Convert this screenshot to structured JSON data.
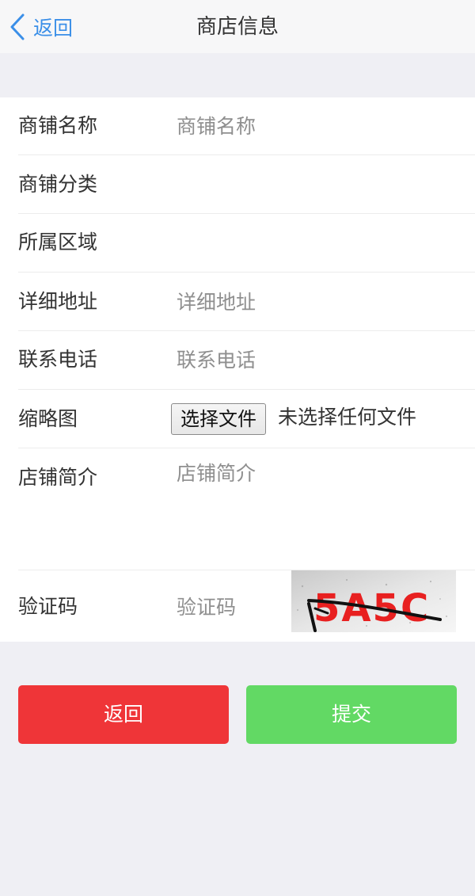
{
  "nav": {
    "back_label": "返回",
    "title": "商店信息"
  },
  "form": {
    "shop_name": {
      "label": "商铺名称",
      "placeholder": "商铺名称",
      "value": ""
    },
    "category": {
      "label": "商铺分类",
      "value": ""
    },
    "region": {
      "label": "所属区域",
      "value": ""
    },
    "address": {
      "label": "详细地址",
      "placeholder": "详细地址",
      "value": ""
    },
    "phone": {
      "label": "联系电话",
      "placeholder": "联系电话",
      "value": ""
    },
    "thumbnail": {
      "label": "缩略图",
      "button_label": "选择文件",
      "status": "未选择任何文件"
    },
    "intro": {
      "label": "店铺简介",
      "placeholder": "店铺简介",
      "value": ""
    },
    "captcha": {
      "label": "验证码",
      "placeholder": "验证码",
      "value": "",
      "image_text": "5A5C"
    }
  },
  "actions": {
    "back_label": "返回",
    "submit_label": "提交"
  },
  "colors": {
    "link": "#3b8fe8",
    "back_button": "#ef3538",
    "submit_button": "#62d964",
    "page_background": "#efeff4"
  },
  "icons": {
    "back": "chevron-left-icon"
  }
}
